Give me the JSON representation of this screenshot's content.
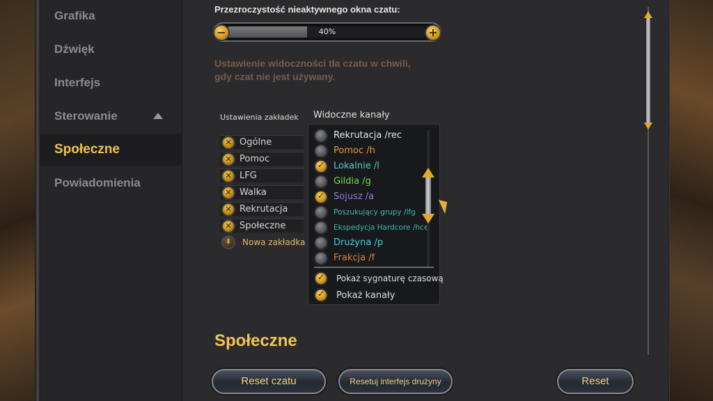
{
  "sidebar": {
    "items": [
      {
        "label": "Grafika",
        "active": false
      },
      {
        "label": "Dźwięk",
        "active": false
      },
      {
        "label": "Interfejs",
        "active": false
      },
      {
        "label": "Sterowanie",
        "active": false
      },
      {
        "label": "Społeczne",
        "active": true
      },
      {
        "label": "Powiadomienia",
        "active": false
      }
    ]
  },
  "chat_opacity": {
    "label": "Przezroczystość nieaktywnego okna czatu:",
    "value_text": "40%",
    "value": 0.4,
    "description": "Ustawienie widoczności tła czatu w chwili, gdy czat nie jest używany."
  },
  "tabs_section": {
    "label": "Ustawienia zakładek",
    "tabs": [
      "Ogólne",
      "Pomoc",
      "LFG",
      "Walka",
      "Rekrutacja",
      "Społeczne"
    ],
    "new_tab_label": "Nowa zakładka"
  },
  "channels_section": {
    "label": "Widoczne kanały",
    "channels": [
      {
        "label": "Rekrutacja /rec",
        "checked": false,
        "color": "#e8e8e8"
      },
      {
        "label": "Pomoc /h",
        "checked": false,
        "color": "#e59a3c"
      },
      {
        "label": "Lokalnie /l",
        "checked": true,
        "color": "#4fd0c8"
      },
      {
        "label": "Gildia /g",
        "checked": false,
        "color": "#6fdd44"
      },
      {
        "label": "Sojusz /a",
        "checked": true,
        "color": "#9a7ae0"
      },
      {
        "label": "Poszukujący grupy /lfg",
        "checked": false,
        "color": "#3fb8b0"
      },
      {
        "label": "Ekspedycja Hardcore /hce",
        "checked": false,
        "color": "#3fb8b0"
      },
      {
        "label": "Drużyna /p",
        "checked": false,
        "color": "#45d2e6"
      },
      {
        "label": "Frakcja /f",
        "checked": false,
        "color": "#e0803a"
      }
    ],
    "options": [
      {
        "label": "Pokaż sygnaturę czasową",
        "checked": true
      },
      {
        "label": "Pokaż kanały",
        "checked": true
      }
    ]
  },
  "section_heading": "Społeczne",
  "buttons": {
    "reset_chat": "Reset czatu",
    "reset_party_ui": "Resetuj interfejs drużyny",
    "reset": "Reset"
  }
}
